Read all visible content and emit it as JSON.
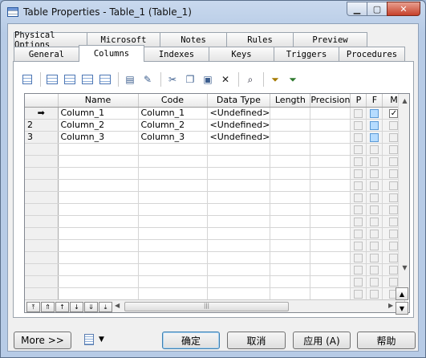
{
  "window": {
    "title": "Table Properties - Table_1 (Table_1)"
  },
  "tabs_row1": [
    "Physical Options",
    "Microsoft",
    "Notes",
    "Rules",
    "Preview"
  ],
  "tabs_row2": [
    "General",
    "Columns",
    "Indexes",
    "Keys",
    "Triggers",
    "Procedures"
  ],
  "active_tab": "Columns",
  "toolbar_icons": [
    "properties-icon",
    "insert-row-icon",
    "add-row-icon",
    "add-columns-icon",
    "reuse-columns-icon",
    "find-icon",
    "paste-icon",
    "cut-icon",
    "copy-icon",
    "paste-clip-icon",
    "delete-icon",
    "find-binoculars-icon",
    "filter-icon",
    "clear-filter-icon"
  ],
  "grid": {
    "headers": [
      "Name",
      "Code",
      "Data Type",
      "Length",
      "Precision",
      "P",
      "F",
      "M"
    ],
    "rows": [
      {
        "marker": "➡",
        "name": "Column_1",
        "code": "Column_1",
        "type": "<Undefined>",
        "p": false,
        "f": true,
        "m": true
      },
      {
        "marker": "2",
        "name": "Column_2",
        "code": "Column_2",
        "type": "<Undefined>",
        "p": false,
        "f": true,
        "m": false
      },
      {
        "marker": "3",
        "name": "Column_3",
        "code": "Column_3",
        "type": "<Undefined>",
        "p": false,
        "f": true,
        "m": false
      }
    ],
    "empty_rows": 14
  },
  "buttons": {
    "more": "More >>",
    "ok": "确定",
    "cancel": "取消",
    "apply": "应用 (A)",
    "help": "帮助"
  },
  "colors": {
    "accent": "#3c7fb1",
    "checkbox_highlight": "#b6dcff"
  }
}
